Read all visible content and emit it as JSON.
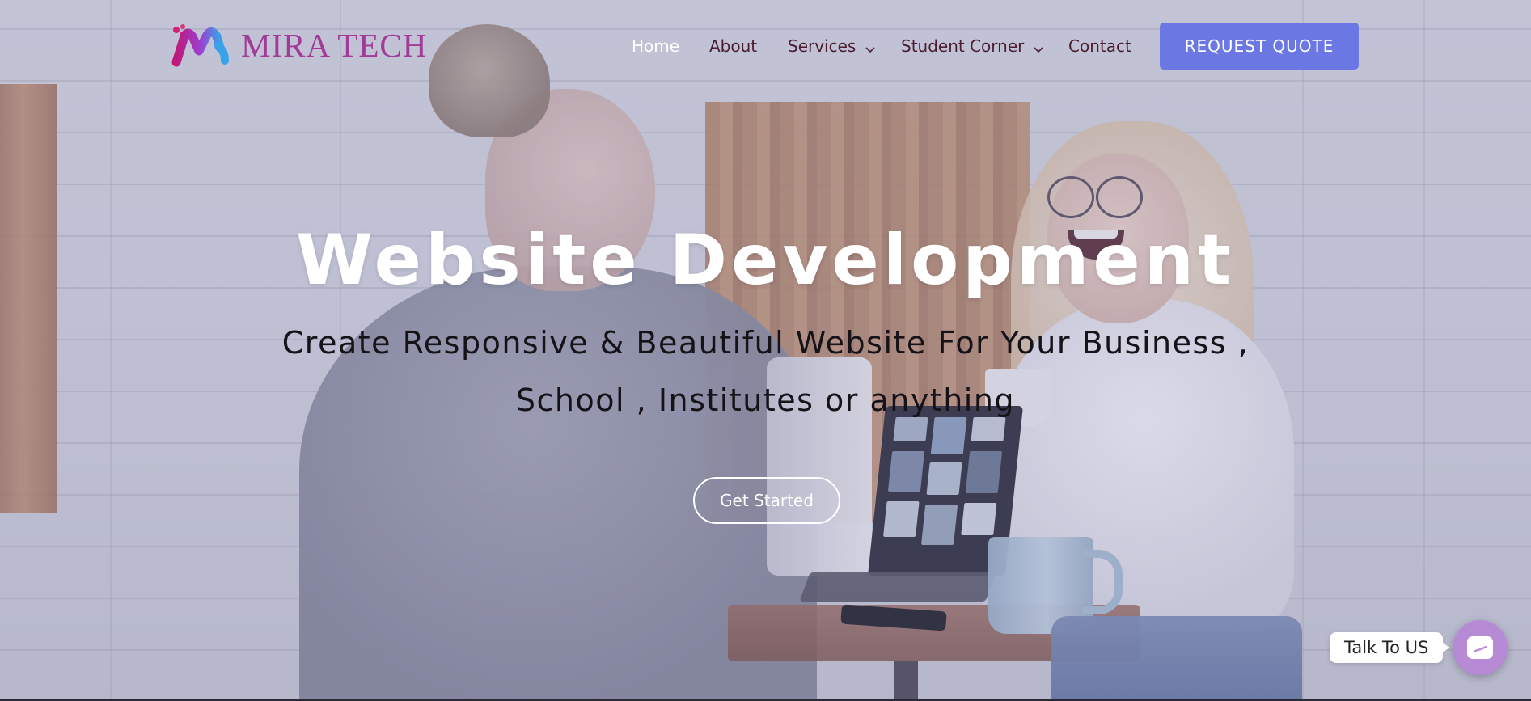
{
  "brand": {
    "name": "MIRA TECH",
    "text_color": "#a23a98",
    "icon": "mira-tech-logo-icon"
  },
  "nav": {
    "items": [
      {
        "label": "Home",
        "active": true
      },
      {
        "label": "About"
      },
      {
        "label": "Services",
        "has_dropdown": true
      },
      {
        "label": "Student Corner",
        "has_dropdown": true
      },
      {
        "label": "Contact"
      }
    ],
    "cta_label": "REQUEST QUOTE",
    "cta_color": "#6b78e3"
  },
  "hero": {
    "headline": "Website Development",
    "subline_1": "Create Responsive & Beautiful Website For Your Business ,",
    "subline_2": "School , Institutes or anything",
    "button_label": "Get Started"
  },
  "chat": {
    "label": "Talk To US",
    "icon": "chat-bubble-icon",
    "color": "#b78ad6"
  }
}
